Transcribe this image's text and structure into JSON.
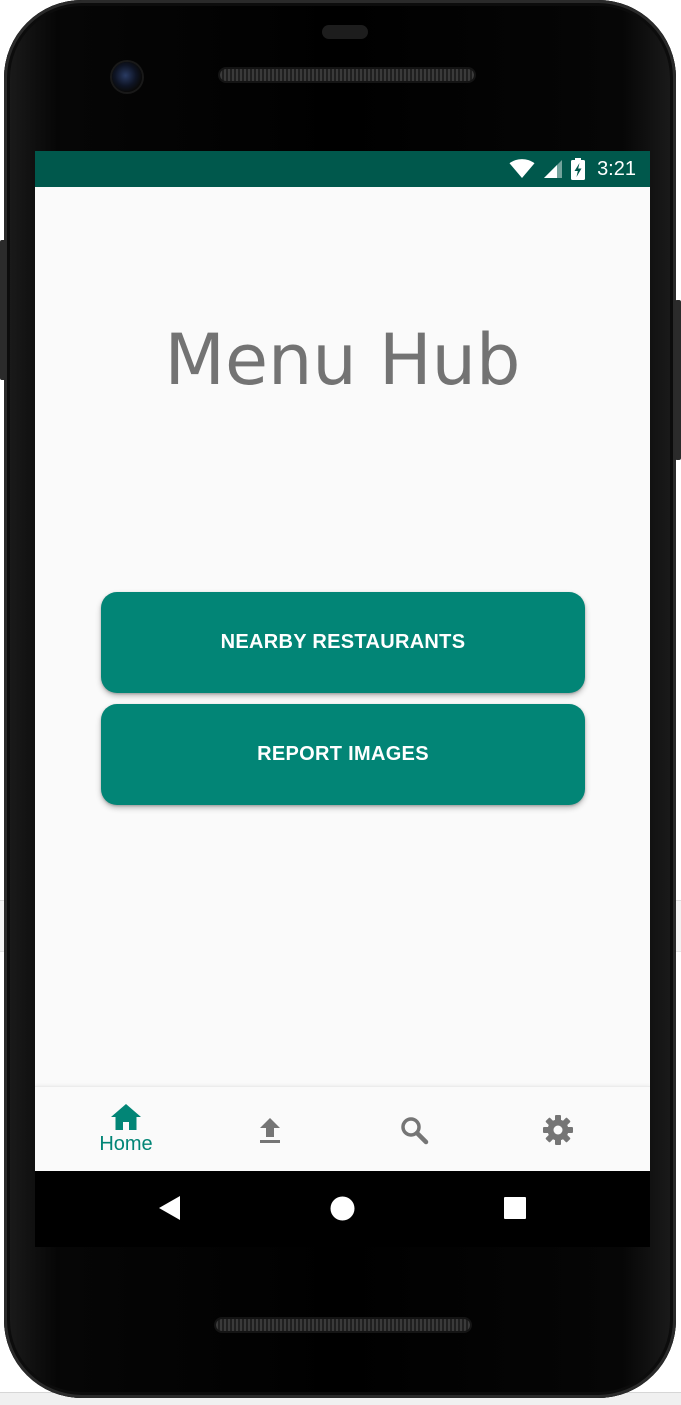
{
  "status_bar": {
    "time": "3:21",
    "icons": [
      "wifi-icon",
      "cellular-signal-icon",
      "battery-charging-icon"
    ],
    "color": "#00584c"
  },
  "app": {
    "title": "Menu Hub"
  },
  "buttons": {
    "nearby_restaurants": "NEARBY RESTAURANTS",
    "report_images": "REPORT IMAGES",
    "color": "#028576"
  },
  "bottom_nav": {
    "selected": "home",
    "items": [
      {
        "id": "home",
        "label": "Home",
        "icon": "home-icon"
      },
      {
        "id": "upload",
        "label": "",
        "icon": "upload-icon"
      },
      {
        "id": "search",
        "label": "",
        "icon": "search-icon"
      },
      {
        "id": "settings",
        "label": "",
        "icon": "settings-gear-icon"
      }
    ],
    "accent": "#028576",
    "inactive": "#757575"
  },
  "system_nav": {
    "icons": [
      "back-icon",
      "home-circle-icon",
      "recents-square-icon"
    ]
  }
}
